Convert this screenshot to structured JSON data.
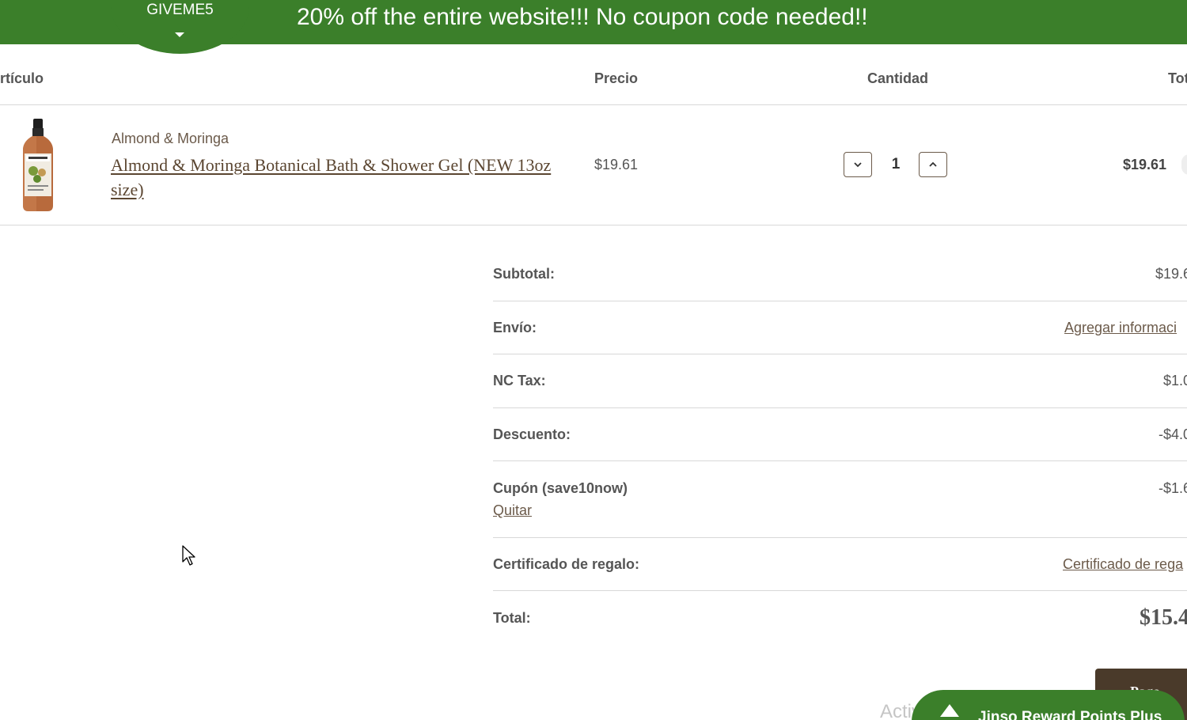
{
  "promo": {
    "coupon_code": "GIVEME5",
    "message": "20% off the entire website!!! No coupon code needed!!"
  },
  "cart": {
    "headers": {
      "item": "rtículo",
      "price": "Precio",
      "quantity": "Cantidad",
      "total": "Tot"
    },
    "items": [
      {
        "brand": "Almond & Moringa",
        "name": "Almond & Moringa Botanical Bath & Shower Gel (NEW 13oz size)",
        "price": "$19.61",
        "quantity": "1",
        "line_total": "$19.61"
      }
    ]
  },
  "totals": {
    "subtotal_label": "Subtotal:",
    "subtotal_value": "$19.6",
    "shipping_label": "Envío:",
    "shipping_link": "Agregar informaci",
    "tax_label": "NC Tax:",
    "tax_value": "$1.0",
    "discount_label": "Descuento:",
    "discount_value": "-$4.0",
    "coupon_label": "Cupón (save10now)",
    "coupon_remove": "Quitar",
    "coupon_value": "-$1.6",
    "gift_label": "Certificado de regalo:",
    "gift_link": "Certificado de rega",
    "total_label": "Total:",
    "total_value": "$15.4"
  },
  "footer": {
    "pay_button": "Pago",
    "rewards_label": "Jinso Reward Points Plus",
    "watermark": "Activar Windows"
  },
  "colors": {
    "brand_green": "#3b7f2a",
    "brand_brown": "#4a3a2a",
    "link_brown": "#6b5a4a"
  }
}
